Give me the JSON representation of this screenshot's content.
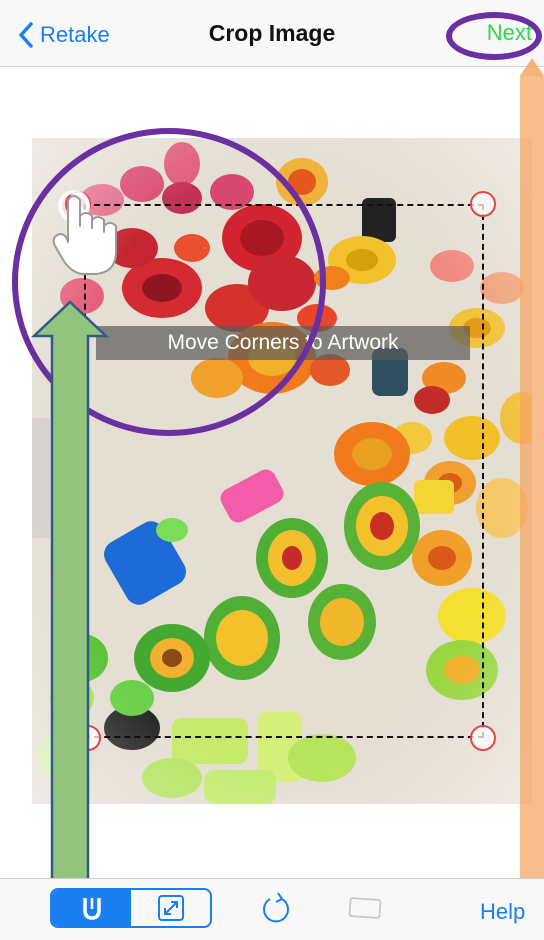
{
  "navbar": {
    "back_label": "Retake",
    "title": "Crop Image",
    "next_label": "Next"
  },
  "overlay": {
    "hint": "Move Corners to Artwork"
  },
  "toolbar": {
    "help_label": "Help"
  },
  "icons": {
    "back": "chevron-left-icon",
    "adjust": "magnet-icon",
    "fullscreen": "expand-icon",
    "rotate": "rotate-icon",
    "aspect": "rectangle-icon",
    "hand": "tap-hand-icon"
  },
  "colors": {
    "accent": "#1a7ff0",
    "next": "#2bd94a",
    "annotation_purple": "#6a2fa0",
    "annotation_green": "#93c47d",
    "annotation_orange": "#f4a460",
    "handle_border": "#e04848"
  }
}
